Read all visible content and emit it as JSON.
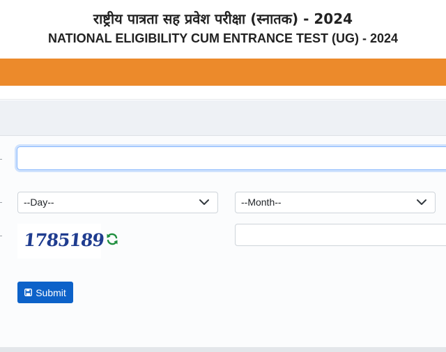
{
  "header": {
    "title_hindi": "राष्ट्रीय पात्रता सह प्रवेश परीक्षा (स्नातक) - 2024",
    "title_english": "NATIONAL ELIGIBILITY CUM ENTRANCE TEST (UG) - 2024"
  },
  "form": {
    "text_field": {
      "value": "",
      "placeholder": ""
    },
    "day_select": {
      "selected": "--Day--"
    },
    "month_select": {
      "selected": "--Month--"
    },
    "captcha": {
      "code": "1785189",
      "refresh_icon": "refresh-icon"
    },
    "captcha_field": {
      "value": "",
      "placeholder": ""
    },
    "submit_label": "Submit",
    "submit_icon": "save-icon"
  },
  "colors": {
    "orange_bar": "#ec8a2b",
    "submit_button": "#0d62c9",
    "captcha_text": "#1f3c8f",
    "refresh_icon": "#1e8e3e"
  }
}
